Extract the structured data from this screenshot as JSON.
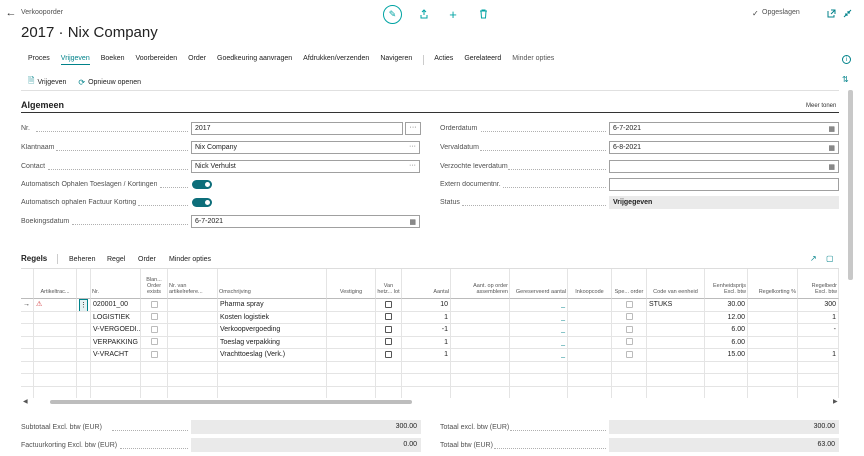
{
  "header": {
    "doc_type": "Verkooporder",
    "title": "2017 · Nix Company",
    "saved_label": "Opgeslagen"
  },
  "menu": {
    "items": [
      "Proces",
      "Vrijgeven",
      "Boeken",
      "Voorbereiden",
      "Order",
      "Goedkeuring aanvragen",
      "Afdrukken/verzenden",
      "Navigeren",
      "Acties",
      "Gerelateerd",
      "Minder opties"
    ]
  },
  "actions": {
    "release": "Vrijgeven",
    "reopen": "Opnieuw openen"
  },
  "general": {
    "title": "Algemeen",
    "show_more": "Meer tonen",
    "labels": {
      "nr": "Nr.",
      "customer": "Klantnaam",
      "contact": "Contact",
      "auto_surcharges": "Automatisch Ophalen Toeslagen / Kortingen",
      "auto_invoice_discount": "Automatisch ophalen Factuur Korting",
      "posting_date": "Boekingsdatum",
      "order_date": "Orderdatum",
      "due_date": "Vervaldatum",
      "requested_delivery": "Verzochte leverdatum",
      "external_doc": "Extern documentnr.",
      "status": "Status"
    },
    "values": {
      "nr": "2017",
      "customer": "Nix Company",
      "contact": "Nick Verhulst",
      "auto_surcharges": true,
      "auto_invoice_discount": true,
      "posting_date": "6-7-2021",
      "order_date": "6-7-2021",
      "due_date": "6-8-2021",
      "requested_delivery": "",
      "external_doc": "",
      "status": "Vrijgegeven"
    }
  },
  "lines": {
    "title": "Regels",
    "toolbar": [
      "Beheren",
      "Regel",
      "Order",
      "Minder opties"
    ],
    "columns": [
      "Artikeltrac...",
      "Nr.",
      "Blan... Order exists",
      "Nr. van artikelrefere...",
      "Omschrijving",
      "Vestiging",
      "Van hetz... lot",
      "Aantal",
      "Aant. op order assembleren",
      "Gereserveerd aantal",
      "Inkoopcode",
      "Spe... order",
      "Code van eenheid",
      "Eenheidsprijs Excl. btw",
      "Regelkorting %",
      "Regelbedr Excl. btw"
    ],
    "rows": [
      {
        "nr": "020001_00",
        "desc": "Pharma spray",
        "qty": "10",
        "reserved": "_",
        "unit": "STUKS",
        "price": "30.00",
        "amount": "300"
      },
      {
        "nr": "LOGISTIEK",
        "desc": "Kosten logistiek",
        "qty": "1",
        "reserved": "_",
        "unit": "",
        "price": "12.00",
        "amount": "1"
      },
      {
        "nr": "V-VERGOEDI...",
        "desc": "Verkoopvergoeding",
        "qty": "-1",
        "reserved": "_",
        "unit": "",
        "price": "6.00",
        "amount": "-"
      },
      {
        "nr": "VERPAKKING",
        "desc": "Toeslag verpakking",
        "qty": "1",
        "reserved": "_",
        "unit": "",
        "price": "6.00",
        "amount": ""
      },
      {
        "nr": "V-VRACHT",
        "desc": "Vrachttoeslag (Verk.)",
        "qty": "1",
        "reserved": "_",
        "unit": "",
        "price": "15.00",
        "amount": "1"
      }
    ]
  },
  "totals": {
    "subtotal_label": "Subtotaal Excl. btw (EUR)",
    "subtotal": "300.00",
    "invoice_discount_label": "Factuurkorting Excl. btw (EUR)",
    "invoice_discount": "0.00",
    "total_excl_label": "Totaal excl. btw (EUR)",
    "total_excl": "300.00",
    "total_vat_label": "Totaal btw (EUR)",
    "total_vat": "63.00"
  },
  "colors": {
    "accent": "#00828a",
    "toggle": "#0d6e7a"
  }
}
